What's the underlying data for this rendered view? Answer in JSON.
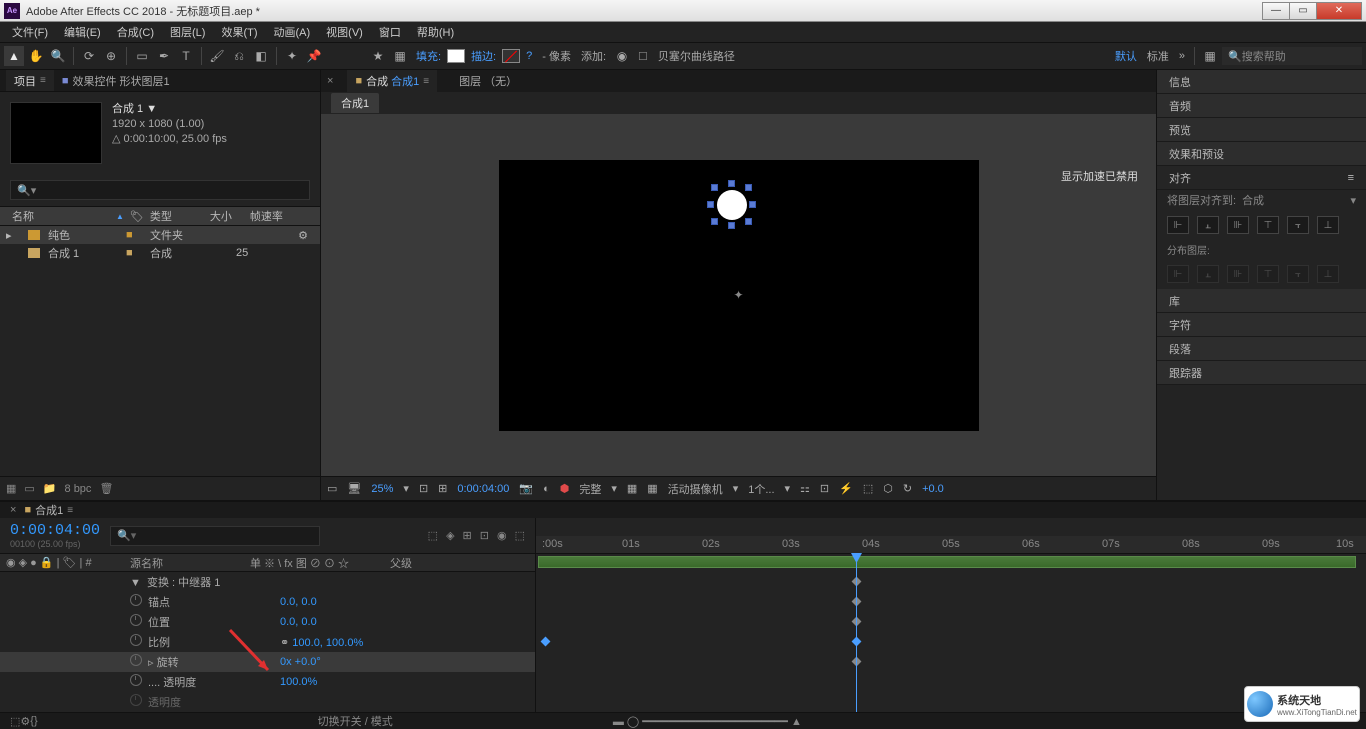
{
  "title": "Adobe After Effects CC 2018 - 无标题项目.aep *",
  "menu": {
    "file": "文件(F)",
    "edit": "编辑(E)",
    "comp": "合成(C)",
    "layer": "图层(L)",
    "effect": "效果(T)",
    "anim": "动画(A)",
    "view": "视图(V)",
    "window": "窗口",
    "help": "帮助(H)"
  },
  "toolbar": {
    "fill": "填充:",
    "stroke": "描边:",
    "stroke_q": "?",
    "px": "- 像素",
    "add": "添加:",
    "bezier": "贝塞尔曲线路径",
    "default": "默认",
    "standard": "标准",
    "search_ph": "搜索帮助"
  },
  "project": {
    "tab_project": "项目",
    "tab_effects": "效果控件 形状图层1",
    "comp_name": "合成 1",
    "dim": "1920 x 1080 (1.00)",
    "dur": "△ 0:00:10:00, 25.00 fps",
    "col_name": "名称",
    "col_type": "类型",
    "col_size": "大小",
    "col_fps": "帧速率",
    "row_solid": "纯色",
    "row_solid_type": "文件夹",
    "row_comp": "合成 1",
    "row_comp_type": "合成",
    "row_comp_fps": "25",
    "bpc": "8 bpc"
  },
  "viewer": {
    "tab_prefix": "合成",
    "tab_comp": "合成1",
    "tab_layer": "图层 （无）",
    "sub_comp": "合成1",
    "hw": "显示加速已禁用",
    "zoom": "25%",
    "time": "0:00:04:00",
    "quality": "完整",
    "camera": "活动摄像机",
    "views": "1个...",
    "exposure": "+0.0"
  },
  "side": {
    "info": "信息",
    "audio": "音频",
    "preview": "预览",
    "effects": "效果和预设",
    "align": "对齐",
    "align_to_lbl": "将图层对齐到:",
    "align_to_val": "合成",
    "distribute": "分布图层:",
    "library": "库",
    "character": "字符",
    "paragraph": "段落",
    "tracker": "跟踪器"
  },
  "timeline": {
    "tab": "合成1",
    "timecode": "0:00:04:00",
    "timecode_sub": "00100 (25.00 fps)",
    "col_source": "源名称",
    "col_switches": "单 ※ \\ fx 图 ⊘ ⊙ ☆",
    "col_parent": "父级",
    "repeater": "变换 : 中继器 1",
    "anchor": "锚点",
    "anchor_v": "0.0, 0.0",
    "position": "位置",
    "position_v": "0.0, 0.0",
    "scale": "比例",
    "scale_v": "100.0, 100.0%",
    "rotation": "旋转",
    "rotation_v": "0x +0.0°",
    "opacity": "透明度",
    "opacity_v": "100.0%",
    "opacity2": "透明度",
    "toggle": "切换开关 / 模式",
    "ticks": [
      ":00s",
      "01s",
      "02s",
      "03s",
      "04s",
      "05s",
      "06s",
      "07s",
      "08s",
      "09s",
      "10s"
    ]
  },
  "watermark": {
    "line1": "系统天地",
    "line2": "www.XiTongTianDi.net"
  }
}
